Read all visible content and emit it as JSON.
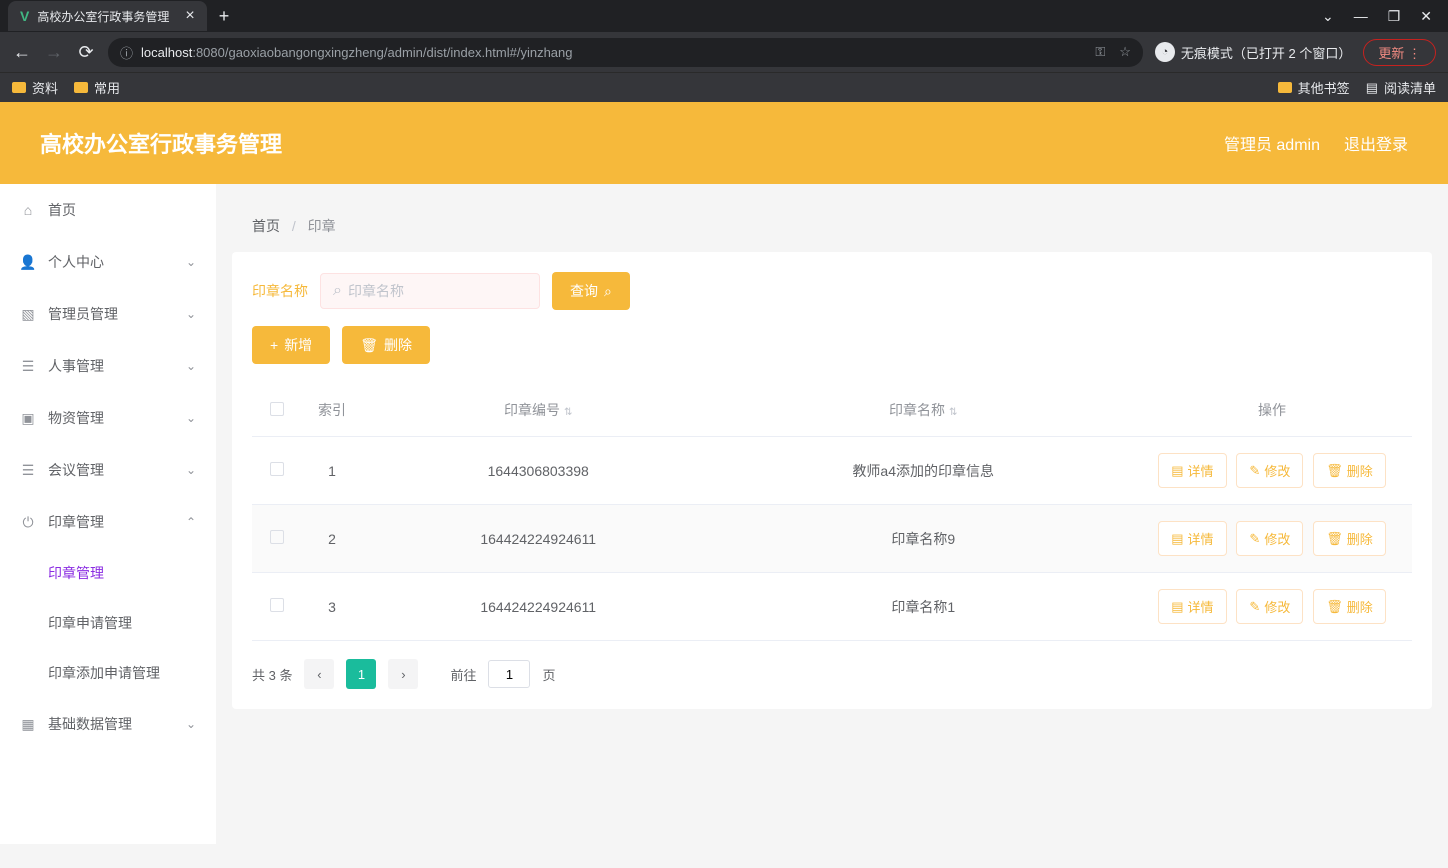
{
  "browser": {
    "tab_title": "高校办公室行政事务管理",
    "url_host": "localhost",
    "url_path": ":8080/gaoxiaobangongxingzheng/admin/dist/index.html#/yinzhang",
    "incognito_text": "无痕模式（已打开 2 个窗口）",
    "update_label": "更新",
    "bookmarks": {
      "item1": "资料",
      "item2": "常用",
      "other": "其他书签",
      "readlist": "阅读清单"
    }
  },
  "header": {
    "title": "高校办公室行政事务管理",
    "user_label": "管理员 admin",
    "logout": "退出登录"
  },
  "sidebar": {
    "home": "首页",
    "personal": "个人中心",
    "admin_mgmt": "管理员管理",
    "hr": "人事管理",
    "materials": "物资管理",
    "meeting": "会议管理",
    "seal": "印章管理",
    "seal_sub1": "印章管理",
    "seal_sub2": "印章申请管理",
    "seal_sub3": "印章添加申请管理",
    "basedata": "基础数据管理"
  },
  "breadcrumb": {
    "home": "首页",
    "current": "印章"
  },
  "search": {
    "label": "印章名称",
    "placeholder": "印章名称",
    "query_btn": "查询"
  },
  "buttons": {
    "add": "新增",
    "delete": "删除"
  },
  "table": {
    "headers": {
      "index": "索引",
      "code": "印章编号",
      "name": "印章名称",
      "ops": "操作"
    },
    "ops": {
      "detail": "详情",
      "edit": "修改",
      "delete": "删除"
    },
    "rows": [
      {
        "idx": "1",
        "code": "1644306803398",
        "name": "教师a4添加的印章信息"
      },
      {
        "idx": "2",
        "code": "164424224924611",
        "name": "印章名称9"
      },
      {
        "idx": "3",
        "code": "164424224924611",
        "name": "印章名称1"
      }
    ]
  },
  "pagination": {
    "total": "共 3 条",
    "goto": "前往",
    "page_value": "1",
    "page_suffix": "页",
    "current": "1"
  }
}
